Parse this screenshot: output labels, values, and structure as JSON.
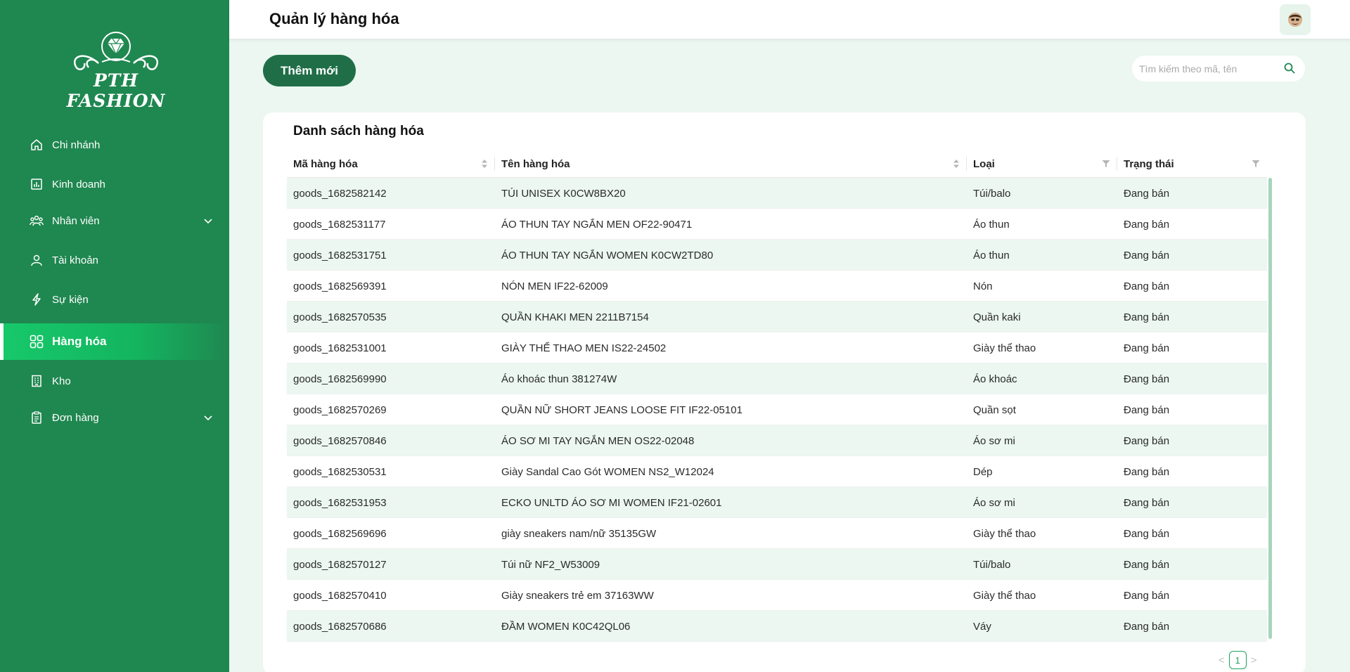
{
  "brand": {
    "logo_text": "PTH FASHION"
  },
  "header": {
    "title": "Quản lý hàng hóa"
  },
  "sidebar": {
    "items": [
      {
        "label": "Chi nhánh",
        "icon": "home-icon"
      },
      {
        "label": "Kinh doanh",
        "icon": "chart-icon"
      },
      {
        "label": "Nhân viên",
        "icon": "team-icon",
        "has_submenu": true
      },
      {
        "label": "Tài khoản",
        "icon": "user-icon"
      },
      {
        "label": "Sự kiện",
        "icon": "bolt-icon"
      },
      {
        "label": "Hàng hóa",
        "icon": "grid-icon",
        "active": true
      },
      {
        "label": "Kho",
        "icon": "building-icon"
      },
      {
        "label": "Đơn hàng",
        "icon": "clipboard-icon",
        "has_submenu": true
      }
    ]
  },
  "toolbar": {
    "add_label": "Thêm mới",
    "search_placeholder": "Tìm kiếm theo mã, tên"
  },
  "table": {
    "title": "Danh sách hàng hóa",
    "columns": [
      "Mã hàng hóa",
      "Tên hàng hóa",
      "Loại",
      "Trạng thái"
    ],
    "rows": [
      [
        "goods_1682582142",
        "TÚI UNISEX K0CW8BX20",
        "Túi/balo",
        "Đang bán"
      ],
      [
        "goods_1682531177",
        "ÁO THUN TAY NGẮN MEN OF22-90471",
        "Áo thun",
        "Đang bán"
      ],
      [
        "goods_1682531751",
        "ÁO THUN TAY NGẮN WOMEN K0CW2TD80",
        "Áo thun",
        "Đang bán"
      ],
      [
        "goods_1682569391",
        "NÓN MEN IF22-62009",
        "Nón",
        "Đang bán"
      ],
      [
        "goods_1682570535",
        "QUẦN KHAKI MEN 2211B7154",
        "Quần kaki",
        "Đang bán"
      ],
      [
        "goods_1682531001",
        "GIÀY THỂ THAO MEN IS22-24502",
        "Giày thể thao",
        "Đang bán"
      ],
      [
        "goods_1682569990",
        "Áo khoác thun 381274W",
        "Áo khoác",
        "Đang bán"
      ],
      [
        "goods_1682570269",
        "QUẦN NỮ SHORT JEANS LOOSE FIT IF22-05101",
        "Quần sọt",
        "Đang bán"
      ],
      [
        "goods_1682570846",
        "ÁO SƠ MI TAY NGẮN MEN OS22-02048",
        "Áo sơ mi",
        "Đang bán"
      ],
      [
        "goods_1682530531",
        "Giày Sandal Cao Gót WOMEN NS2_W12024",
        "Dép",
        "Đang bán"
      ],
      [
        "goods_1682531953",
        "ECKO UNLTD ÁO SƠ MI WOMEN IF21-02601",
        "Áo sơ mi",
        "Đang bán"
      ],
      [
        "goods_1682569696",
        "giày sneakers nam/nữ 35135GW",
        "Giày thể thao",
        "Đang bán"
      ],
      [
        "goods_1682570127",
        "Túi nữ NF2_W53009",
        "Túi/balo",
        "Đang bán"
      ],
      [
        "goods_1682570410",
        "Giày sneakers trẻ em 37163WW",
        "Giày thể thao",
        "Đang bán"
      ],
      [
        "goods_1682570686",
        "ĐẦM WOMEN K0C42QL06",
        "Váy",
        "Đang bán"
      ]
    ]
  },
  "pagination": {
    "current_page": "1",
    "prev": "<",
    "next": ">"
  },
  "colors": {
    "sidebar": "#1f8750",
    "accent": "#1f6e47",
    "active": "#17c96a",
    "row_alt": "#ebf7f0"
  }
}
